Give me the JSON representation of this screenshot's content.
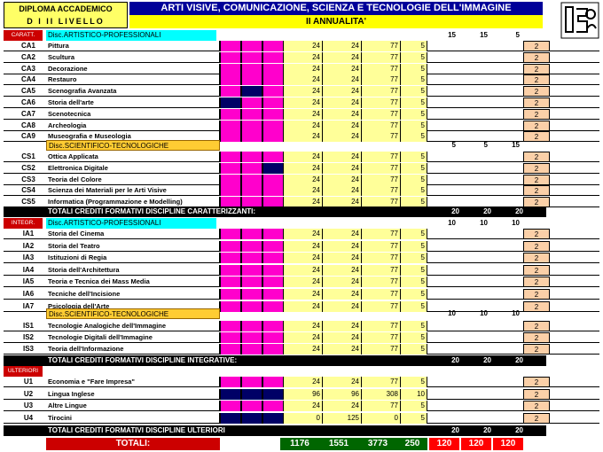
{
  "header": {
    "left_line1": "DIPLOMA ACCADEMICO",
    "left_line2": "D I   II LIVELLO",
    "title": "ARTI VISIVE, COMUNICAZIONE, SCIENZA E TECNOLOGIE DELL'IMMAGINE",
    "subtitle": "II ANNUALITA'"
  },
  "sections": {
    "caratt": "CARATT.",
    "integr": "INTEGR.",
    "ulteriori": "ULTERIORI"
  },
  "groups": {
    "caratt_artistico": {
      "label": "Disc.ARTISTICO-PROFESSIONALI",
      "n1": "15",
      "n2": "15",
      "n3": "5"
    },
    "caratt_scientifico": {
      "label": "Disc.SCIENTIFICO-TECNOLOGICHE",
      "n1": "5",
      "n2": "5",
      "n3": "15"
    },
    "integr_artistico": {
      "label": "Disc.ARTISTICO-PROFESSIONALI",
      "n1": "10",
      "n2": "10",
      "n3": "10"
    },
    "integr_scientifico": {
      "label": "Disc.SCIENTIFICO-TECNOLOGICHE",
      "n1": "10",
      "n2": "10",
      "n3": "10"
    }
  },
  "rows_caratt_a": [
    {
      "code": "CA1",
      "name": "Pittura",
      "v1": "24",
      "v2": "24",
      "v3": "77",
      "v4": "5",
      "cr": "2"
    },
    {
      "code": "CA2",
      "name": "Scultura",
      "v1": "24",
      "v2": "24",
      "v3": "77",
      "v4": "5",
      "cr": "2"
    },
    {
      "code": "CA3",
      "name": "Decorazione",
      "v1": "24",
      "v2": "24",
      "v3": "77",
      "v4": "5",
      "cr": "2"
    },
    {
      "code": "CA4",
      "name": "Restauro",
      "v1": "24",
      "v2": "24",
      "v3": "77",
      "v4": "5",
      "cr": "2"
    },
    {
      "code": "CA5",
      "name": "Scenografia Avanzata",
      "v1": "24",
      "v2": "24",
      "v3": "77",
      "v4": "5",
      "cr": "2"
    },
    {
      "code": "CA6",
      "name": "Storia dell'arte",
      "v1": "24",
      "v2": "24",
      "v3": "77",
      "v4": "5",
      "cr": "2"
    },
    {
      "code": "CA7",
      "name": "Scenotecnica",
      "v1": "24",
      "v2": "24",
      "v3": "77",
      "v4": "5",
      "cr": "2"
    },
    {
      "code": "CA8",
      "name": "Archeologia",
      "v1": "24",
      "v2": "24",
      "v3": "77",
      "v4": "5",
      "cr": "2"
    },
    {
      "code": "CA9",
      "name": "Museografia e Museologia",
      "v1": "24",
      "v2": "24",
      "v3": "77",
      "v4": "5",
      "cr": "2"
    }
  ],
  "rows_caratt_s": [
    {
      "code": "CS1",
      "name": "Ottica Applicata",
      "v1": "24",
      "v2": "24",
      "v3": "77",
      "v4": "5",
      "cr": "2"
    },
    {
      "code": "CS2",
      "name": "Elettronica Digitale",
      "v1": "24",
      "v2": "24",
      "v3": "77",
      "v4": "5",
      "cr": "2"
    },
    {
      "code": "CS3",
      "name": "Teoria del Colore",
      "v1": "24",
      "v2": "24",
      "v3": "77",
      "v4": "5",
      "cr": "2"
    },
    {
      "code": "CS4",
      "name": "Scienza dei Materiali per le Arti Visive",
      "v1": "24",
      "v2": "24",
      "v3": "77",
      "v4": "5",
      "cr": "2"
    },
    {
      "code": "CS5",
      "name": "Informatica (Programmazione e Modelling)",
      "v1": "24",
      "v2": "24",
      "v3": "77",
      "v4": "5",
      "cr": "2"
    }
  ],
  "total_caratt": {
    "label": "TOTALI CREDITI FORMATIVI DISCIPLINE CARATTERIZZANTI:",
    "n1": "20",
    "n2": "20",
    "n3": "20"
  },
  "rows_integr_a": [
    {
      "code": "IA1",
      "name": "Storia del Cinema",
      "v1": "24",
      "v2": "24",
      "v3": "77",
      "v4": "5",
      "cr": "2"
    },
    {
      "code": "IA2",
      "name": "Storia del Teatro",
      "v1": "24",
      "v2": "24",
      "v3": "77",
      "v4": "5",
      "cr": "2"
    },
    {
      "code": "IA3",
      "name": "Istituzioni di Regia",
      "v1": "24",
      "v2": "24",
      "v3": "77",
      "v4": "5",
      "cr": "2"
    },
    {
      "code": "IA4",
      "name": "Storia dell'Architettura",
      "v1": "24",
      "v2": "24",
      "v3": "77",
      "v4": "5",
      "cr": "2"
    },
    {
      "code": "IA5",
      "name": "Teoria e Tecnica dei Mass Media",
      "v1": "24",
      "v2": "24",
      "v3": "77",
      "v4": "5",
      "cr": "2"
    },
    {
      "code": "IA6",
      "name": "Tecniche dell'Incisione",
      "v1": "24",
      "v2": "24",
      "v3": "77",
      "v4": "5",
      "cr": "2"
    },
    {
      "code": "IA7",
      "name": "Psicologia dell'Arte",
      "v1": "24",
      "v2": "24",
      "v3": "77",
      "v4": "5",
      "cr": "2"
    }
  ],
  "rows_integr_s": [
    {
      "code": "IS1",
      "name": "Tecnologie Analogiche dell'Immagine",
      "v1": "24",
      "v2": "24",
      "v3": "77",
      "v4": "5",
      "cr": "2"
    },
    {
      "code": "IS2",
      "name": "Tecnologie Digitali dell'Immagine",
      "v1": "24",
      "v2": "24",
      "v3": "77",
      "v4": "5",
      "cr": "2"
    },
    {
      "code": "IS3",
      "name": "Teoria dell'Informazione",
      "v1": "24",
      "v2": "24",
      "v3": "77",
      "v4": "5",
      "cr": "2"
    }
  ],
  "total_integr": {
    "label": "TOTALI CREDITI FORMATIVI DISCIPLINE INTEGRATIVE:",
    "n1": "20",
    "n2": "20",
    "n3": "20"
  },
  "rows_ulteriori": [
    {
      "code": "U1",
      "name": "Economia e \"Fare Impresa\"",
      "v1": "24",
      "v2": "24",
      "v3": "77",
      "v4": "5",
      "cr": "2"
    },
    {
      "code": "U2",
      "name": "Lingua Inglese",
      "v1": "96",
      "v2": "96",
      "v3": "308",
      "v4": "10",
      "cr": "2"
    },
    {
      "code": "U3",
      "name": "Altre Lingue",
      "v1": "24",
      "v2": "24",
      "v3": "77",
      "v4": "5",
      "cr": "2"
    },
    {
      "code": "U4",
      "name": "Tirocini",
      "v1": "0",
      "v2": "125",
      "v3": "0",
      "v4": "5",
      "cr": "2"
    }
  ],
  "total_ulteriori": {
    "label": "TOTALI CREDITI FORMATIVI DISCIPLINE ULTERIORI",
    "n1": "20",
    "n2": "20",
    "n3": "20"
  },
  "grand_total": {
    "label": "TOTALI:",
    "g1": "1176",
    "g2": "1551",
    "g3": "3773",
    "g4": "250",
    "r1": "120",
    "r2": "120",
    "r3": "120"
  },
  "colors": {
    "magenta": "#ff00cc",
    "navy": "#000066",
    "yellow": "#ffff00",
    "red": "#cc0000",
    "green": "#006600"
  }
}
